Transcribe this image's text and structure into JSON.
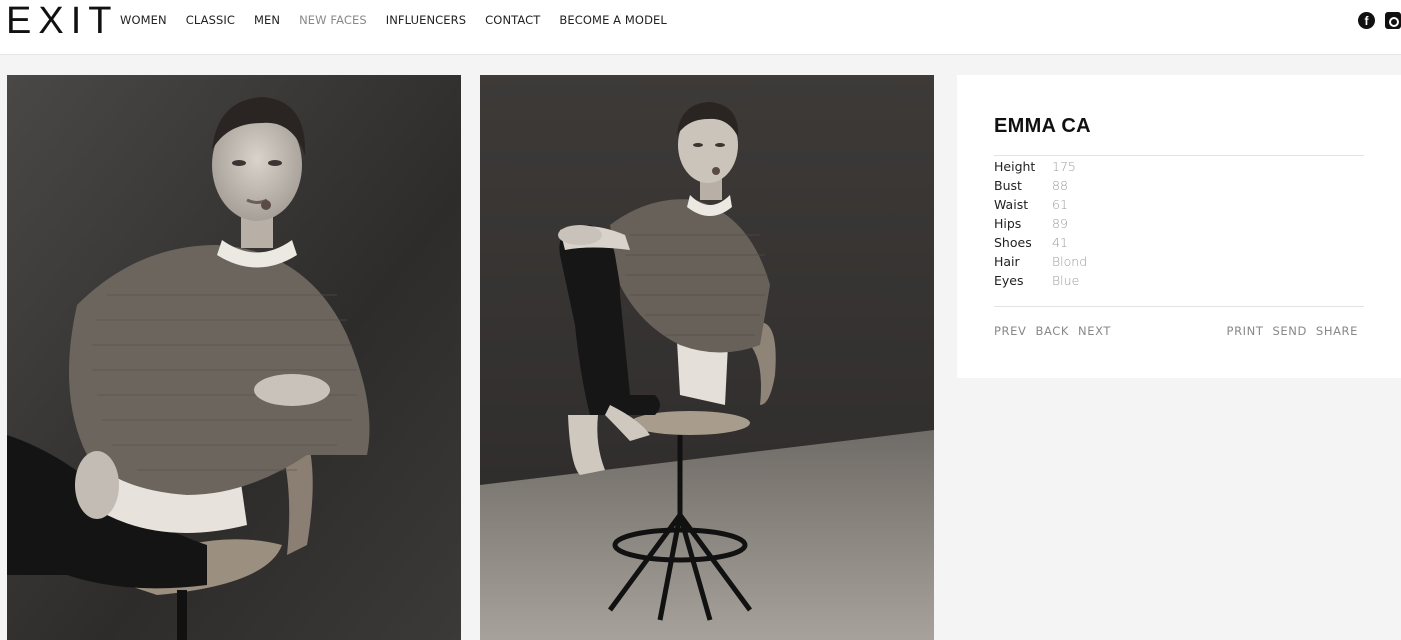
{
  "header": {
    "logo": "EXIT",
    "nav": [
      {
        "label": "WOMEN"
      },
      {
        "label": "CLASSIC"
      },
      {
        "label": "MEN"
      },
      {
        "label": "NEW FACES",
        "active": true
      },
      {
        "label": "INFLUENCERS"
      },
      {
        "label": "CONTACT"
      },
      {
        "label": "BECOME A MODEL"
      }
    ],
    "social": {
      "facebook_glyph": "f",
      "icons": [
        "facebook-icon",
        "instagram-icon"
      ]
    }
  },
  "model": {
    "name": "EMMA CA",
    "stats": [
      {
        "label": "Height",
        "value": "175"
      },
      {
        "label": "Bust",
        "value": "88"
      },
      {
        "label": "Waist",
        "value": "61"
      },
      {
        "label": "Hips",
        "value": "89"
      },
      {
        "label": "Shoes",
        "value": "41"
      },
      {
        "label": "Hair",
        "value": "Blond"
      },
      {
        "label": "Eyes",
        "value": "Blue"
      }
    ]
  },
  "actions": {
    "left": [
      "PREV",
      "BACK",
      "NEXT"
    ],
    "right": [
      "PRINT",
      "SEND",
      "SHARE"
    ]
  },
  "colors": {
    "accent": "#111111",
    "muted": "#888888",
    "page_bg": "#f4f4f4"
  }
}
